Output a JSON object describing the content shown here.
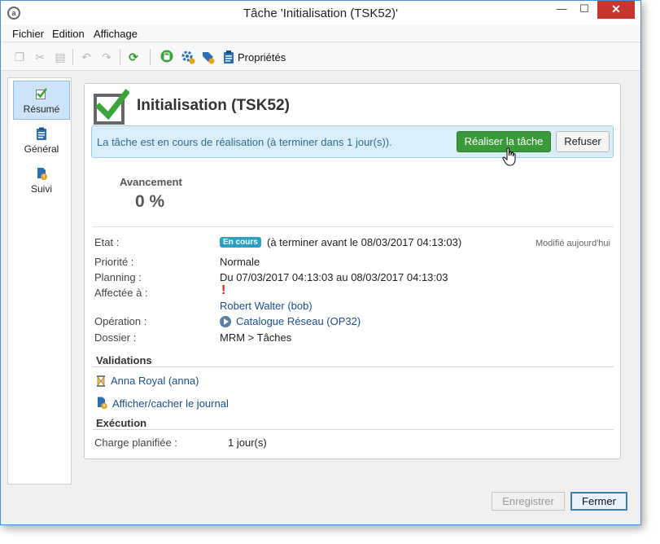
{
  "window": {
    "title": "Tâche 'Initialisation (TSK52)'"
  },
  "menu": [
    "Fichier",
    "Edition",
    "Affichage"
  ],
  "toolbar": {
    "properties_label": "Propriétés"
  },
  "sidebar": {
    "items": [
      {
        "label": "Résumé"
      },
      {
        "label": "Général"
      },
      {
        "label": "Suivi"
      }
    ]
  },
  "task": {
    "title": "Initialisation (TSK52)",
    "info_message": "La tâche est en cours de réalisation (à terminer dans 1 jour(s)).",
    "do_task_label": "Réaliser la tâche",
    "refuse_label": "Refuser",
    "progress_label": "Avancement",
    "progress_value": "0 %"
  },
  "fields": {
    "etat_label": "Etat :",
    "etat_badge": "En cours",
    "etat_text": "(à terminer avant le 08/03/2017 04:13:03)",
    "modified": "Modifié aujourd'hui",
    "priorite_label": "Priorité :",
    "priorite_value": "Normale",
    "planning_label": "Planning :",
    "planning_value": "Du 07/03/2017 04:13:03 au 08/03/2017 04:13:03",
    "affectee_label": "Affectée à :",
    "affectee_value": "Robert Walter (bob)",
    "operation_label": "Opération :",
    "operation_value": "Catalogue Réseau (OP32)",
    "dossier_label": "Dossier :",
    "dossier_value": "MRM > Tâches"
  },
  "validations": {
    "title": "Validations",
    "validator": "Anna Royal (anna)",
    "journal_link": "Afficher/cacher le journal"
  },
  "execution": {
    "title": "Exécution",
    "charge_label": "Charge planifiée :",
    "charge_value": "1 jour(s)"
  },
  "footer": {
    "register_label": "Enregistrer",
    "close_label": "Fermer"
  }
}
